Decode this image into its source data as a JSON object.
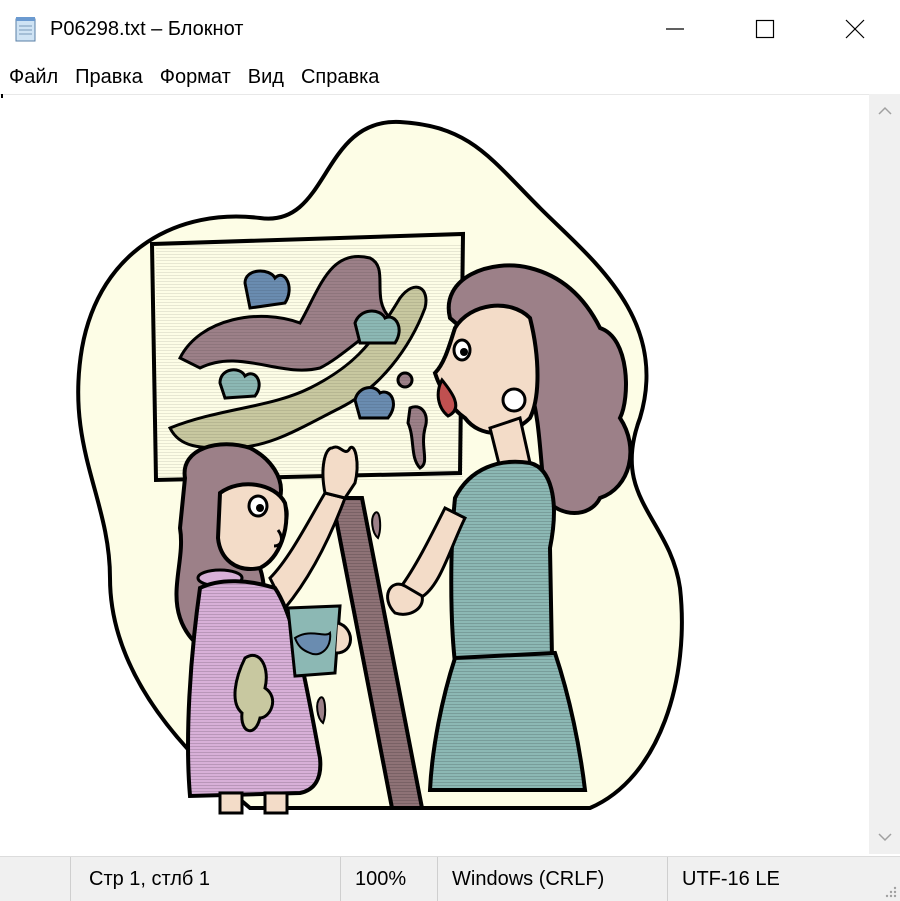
{
  "window": {
    "title": "P06298.txt – Блокнот",
    "app_icon": "notepad-icon",
    "buttons": [
      "minimize-icon",
      "maximize-icon",
      "close-icon"
    ]
  },
  "menu": {
    "items": [
      "Файл",
      "Правка",
      "Формат",
      "Вид",
      "Справка"
    ]
  },
  "editor": {
    "content": "clip-art picture: mother and daughter painting a picture on an easel"
  },
  "scrollbar": {
    "up_icon": "chevron-up-icon",
    "down_icon": "chevron-down-icon"
  },
  "status": {
    "position": "Стр 1, стлб 1",
    "zoom": "100%",
    "line_endings": "Windows (CRLF)",
    "encoding": "UTF-16 LE"
  },
  "colors": {
    "background_blob": "#fdfde6",
    "hair": "#9c8088",
    "skin": "#f3dcc8",
    "dress": "#d8b0d8",
    "teal": "#8cb8b4",
    "olive": "#c8c8a0",
    "easel": "#8e7276"
  }
}
